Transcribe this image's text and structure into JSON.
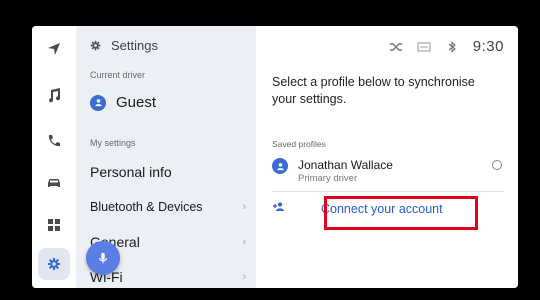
{
  "settings": {
    "title": "Settings",
    "current_driver_label": "Current driver",
    "current_driver": "Guest",
    "my_settings_label": "My settings",
    "menu": [
      {
        "label": "Personal info",
        "chevron": false
      },
      {
        "label": "Bluetooth & Devices",
        "chevron": true
      },
      {
        "label": "General",
        "chevron": true
      },
      {
        "label": "Wi-Fi",
        "chevron": true
      }
    ]
  },
  "status": {
    "time": "9:30",
    "icons": [
      "shuffle-off-icon",
      "signal-icon",
      "bluetooth-icon"
    ]
  },
  "content": {
    "instruction": "Select a profile below to synchronise your settings.",
    "saved_profiles_label": "Saved profiles",
    "profile": {
      "name": "Jonathan Wallace",
      "role": "Primary driver"
    },
    "connect_label": "Connect your account"
  },
  "rail": {
    "icons": [
      "navigation-icon",
      "music-icon",
      "phone-icon",
      "car-icon",
      "apps-icon",
      "settings-icon"
    ]
  },
  "colors": {
    "accent": "#3b6cd6",
    "link": "#2b58d4",
    "highlight_box": "#e0001b",
    "pane_bg": "#eceff3"
  }
}
